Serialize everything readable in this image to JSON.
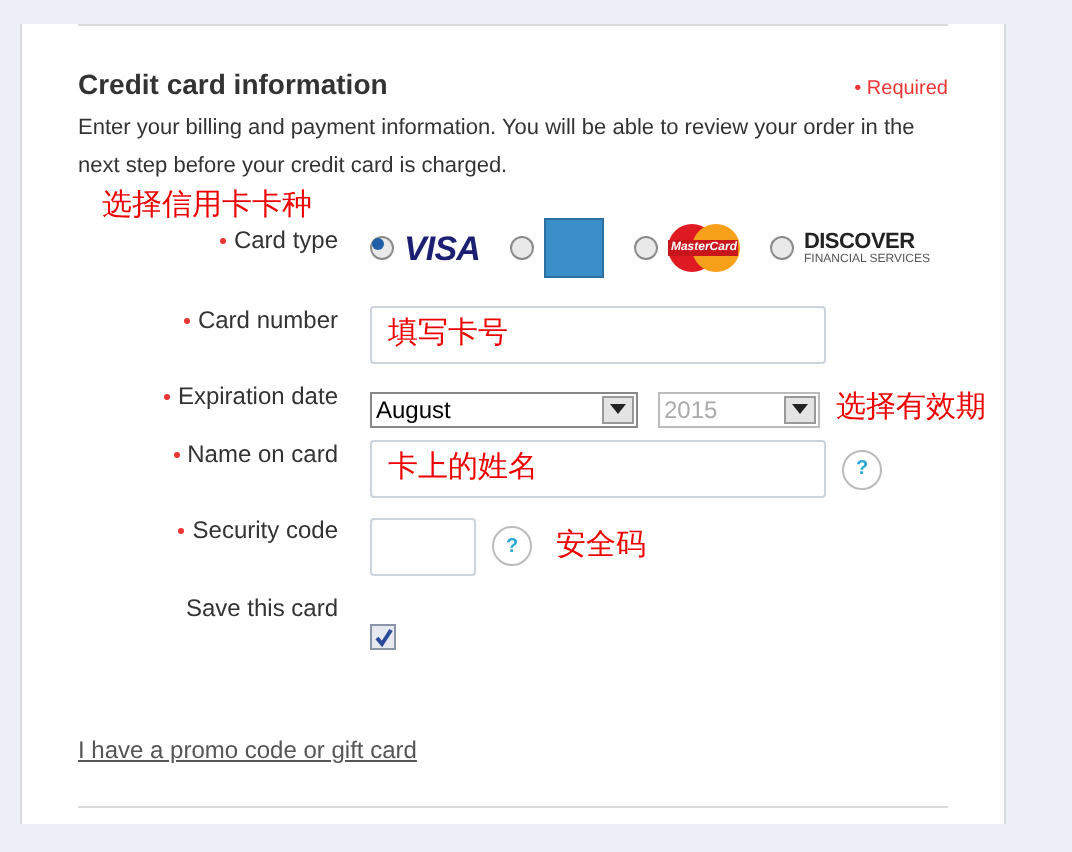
{
  "section": {
    "title": "Credit card information",
    "required_note": "• Required",
    "description": "Enter your billing and payment information. You will be able to review your order in the next step before your credit card is charged."
  },
  "fields": [
    {
      "kind": "card-type",
      "label": "Card type",
      "required": true,
      "annotation": "选择信用卡卡种",
      "options": [
        {
          "kind": "visa",
          "logo_text": "VISA",
          "selected": true
        },
        {
          "kind": "amex",
          "selected": false
        },
        {
          "kind": "mastercard",
          "logo_text": "MasterCard",
          "selected": false
        },
        {
          "kind": "discover",
          "logo_text": "DISCOVER",
          "sub_text": "FINANCIAL SERVICES",
          "selected": false
        }
      ]
    },
    {
      "kind": "text",
      "label": "Card number",
      "required": true,
      "annotation": "填写卡号"
    },
    {
      "kind": "expiry",
      "label": "Expiration date",
      "required": true,
      "month": "August",
      "year": "2015",
      "year_disabled": true,
      "annotation": "选择有效期"
    },
    {
      "kind": "text",
      "label": "Name on card",
      "required": true,
      "annotation": "卡上的姓名",
      "help": "?"
    },
    {
      "kind": "short-text",
      "label": "Security code",
      "required": true,
      "help": "?",
      "annotation": "安全码"
    },
    {
      "kind": "checkbox",
      "label": "Save this card",
      "required": false,
      "checked": true
    }
  ],
  "promo_link": "I have a promo code or gift card"
}
